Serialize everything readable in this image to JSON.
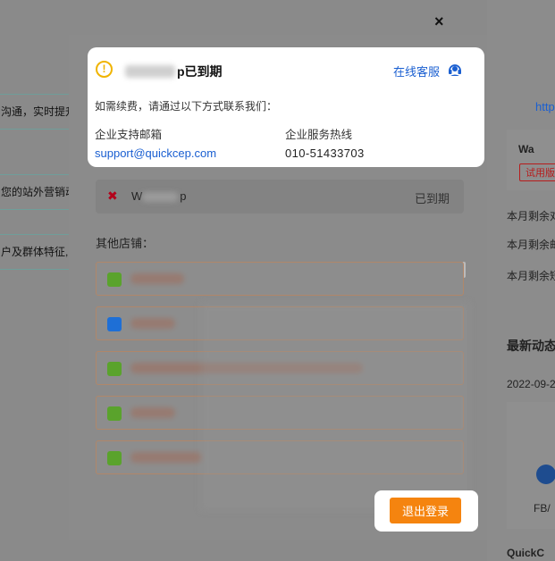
{
  "background": {
    "left_rows": [
      "沟通，实时提升",
      "您的站外营销动",
      "户及群体特征,"
    ],
    "right_texts": {
      "link": "http",
      "shop_name": "Wa",
      "trial_badge": "试用版",
      "remain_1": "本月剩余对",
      "remain_2": "本月剩余邮",
      "remain_3": "本月剩余短",
      "latest": "最新动态",
      "date": "2022-09-2",
      "fb": "FB/",
      "quick": "QuickC"
    },
    "close_symbol": "×"
  },
  "alert": {
    "title_suffix": "p已到期",
    "service_link": "在线客服",
    "description": "如需续费，请通过以下方式联系我们：",
    "email_label": "企业支持邮箱",
    "email_value": "support@quickcep.com",
    "phone_label": "企业服务热线",
    "phone_value": "010-51433703"
  },
  "current_shop": {
    "name": "W",
    "name_suffix": "p",
    "status": "已到期"
  },
  "other_shops": {
    "label": "其他店铺："
  },
  "shops": [
    {
      "icon": "shopify-icon",
      "color": "#5aa32c",
      "blur_width": 60
    },
    {
      "icon": "store-icon",
      "color": "#1e6fd6",
      "blur_width": 50
    },
    {
      "icon": "shopify-icon",
      "color": "#5aa32c",
      "blur_width": 260
    },
    {
      "icon": "shopify-icon",
      "color": "#5aa32c",
      "blur_width": 50
    },
    {
      "icon": "shopify-icon",
      "color": "#5aa32c",
      "blur_width": 80
    }
  ],
  "logout": {
    "label": "退出登录"
  }
}
